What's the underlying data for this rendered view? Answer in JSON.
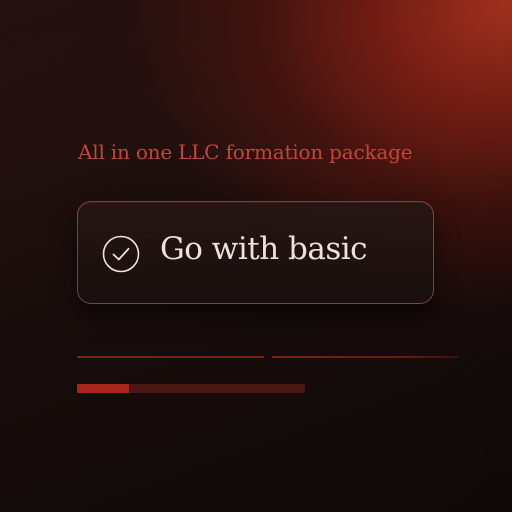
{
  "tagline": "All in one LLC formation package",
  "cta": {
    "label": "Go with basic",
    "icon": "check-circle-icon"
  },
  "progress": {
    "fraction": 0.23
  },
  "colors": {
    "accent": "#c2463a",
    "button_text": "#eee2d8",
    "progress_fill": "#a8241d",
    "progress_track": "#4a1714"
  }
}
